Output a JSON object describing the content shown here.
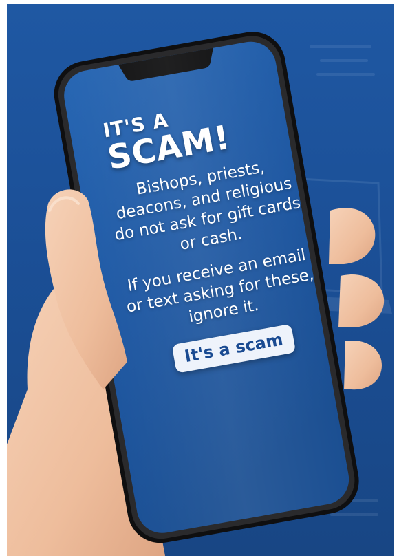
{
  "poster": {
    "kicker": "IT'S A",
    "headline": "SCAM!",
    "paragraph1": "Bishops, priests, deacons, and religious do not ask for gift cards or cash.",
    "paragraph2": "If you receive an email or text asking for these, ignore it.",
    "button_label": "It's a scam"
  },
  "colors": {
    "background_blue": "#1f58a3",
    "screen_blue": "#1e5aa6",
    "phone_bezel": "#141414",
    "text": "#ffffff",
    "button_bg": "#eef3fb",
    "button_text": "#1a4b92",
    "skin": "#f0c4a6"
  },
  "icons": [
    "smartphone-icon",
    "hand-illustration"
  ]
}
